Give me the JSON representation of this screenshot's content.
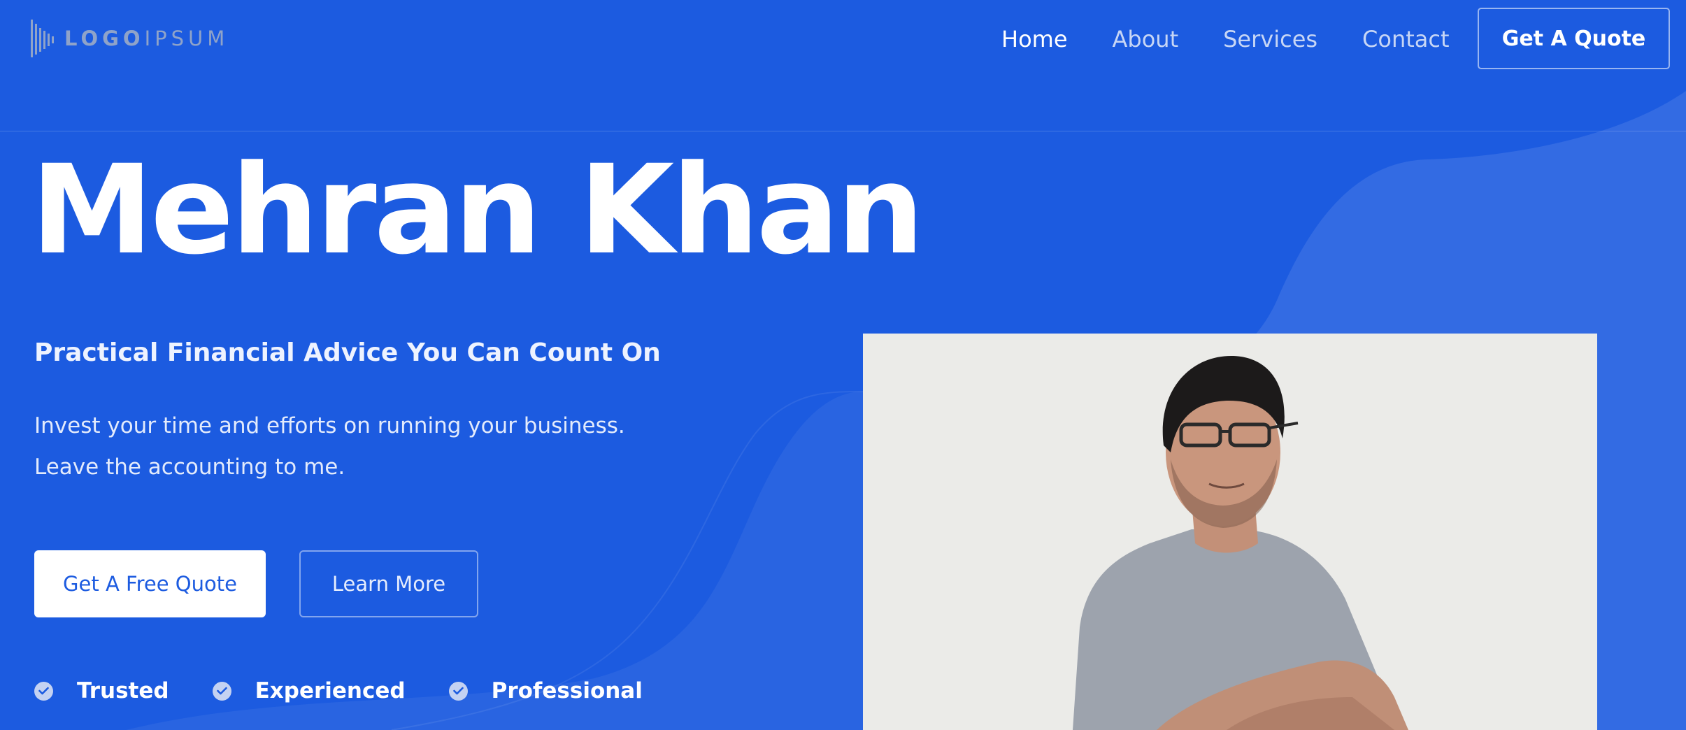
{
  "logo": {
    "text_bold": "LOGO",
    "text_light": "IPSUM"
  },
  "nav": {
    "items": [
      {
        "label": "Home",
        "active": true
      },
      {
        "label": "About",
        "active": false
      },
      {
        "label": "Services",
        "active": false
      },
      {
        "label": "Contact",
        "active": false
      }
    ],
    "cta_label": "Get A Quote"
  },
  "hero": {
    "title": "Mehran Khan",
    "subtitle": "Practical Financial Advice You Can Count On",
    "description_lines": [
      "Invest your time and efforts on running your business.",
      "Leave the accounting to me."
    ],
    "primary_button": "Get A Free Quote",
    "secondary_button": "Learn More",
    "features": [
      "Trusted",
      "Experienced",
      "Professional"
    ]
  },
  "colors": {
    "background": "#1c5be0",
    "accent_white": "#ffffff",
    "nav_text": "#c7d6f5"
  },
  "icons": {
    "logo": "logo-bars-icon",
    "feature": "check-circle-icon"
  }
}
